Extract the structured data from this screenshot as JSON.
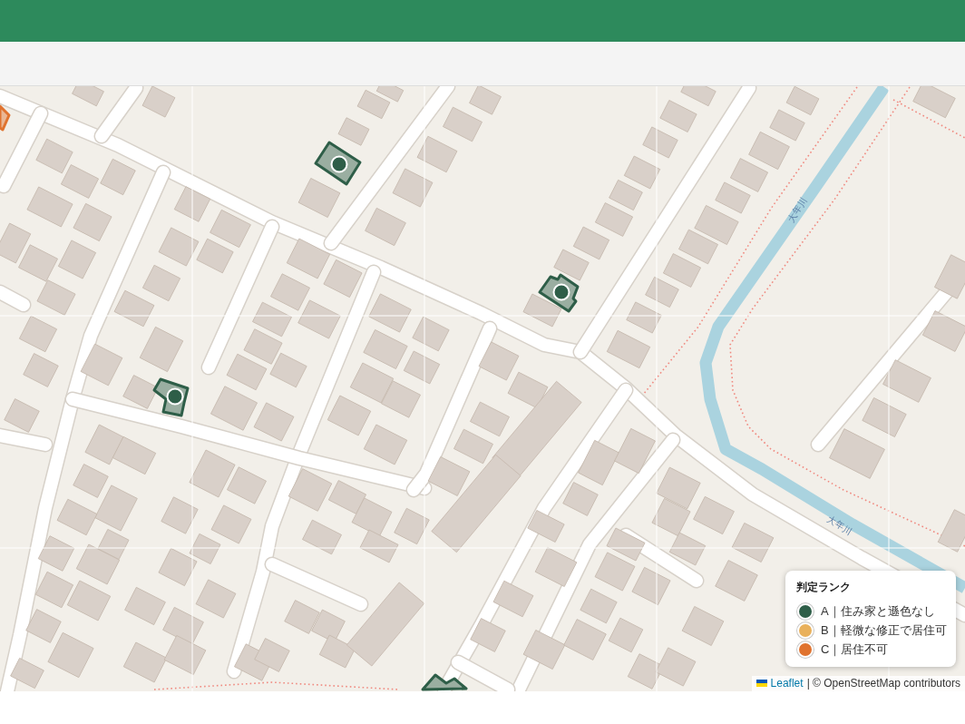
{
  "map": {
    "markers": [
      {
        "color": "#e0732f"
      },
      {
        "color": "#2e5e48"
      },
      {
        "color": "#2e5e48"
      },
      {
        "color": "#2e5e48"
      },
      {
        "color": "#2e5e48"
      }
    ],
    "labels": [
      {
        "text": "大年川"
      },
      {
        "text": "大年川"
      }
    ]
  },
  "legend": {
    "title": "判定ランク",
    "items": [
      {
        "label": "A｜住み家と遜色なし",
        "color": "#2e5e48"
      },
      {
        "label": "B｜軽微な修正で居住可",
        "color": "#e9b15c"
      },
      {
        "label": "C｜居住不可",
        "color": "#e0732f"
      }
    ]
  },
  "attribution": {
    "link": "Leaflet",
    "text": "| © OpenStreetMap contributors"
  }
}
